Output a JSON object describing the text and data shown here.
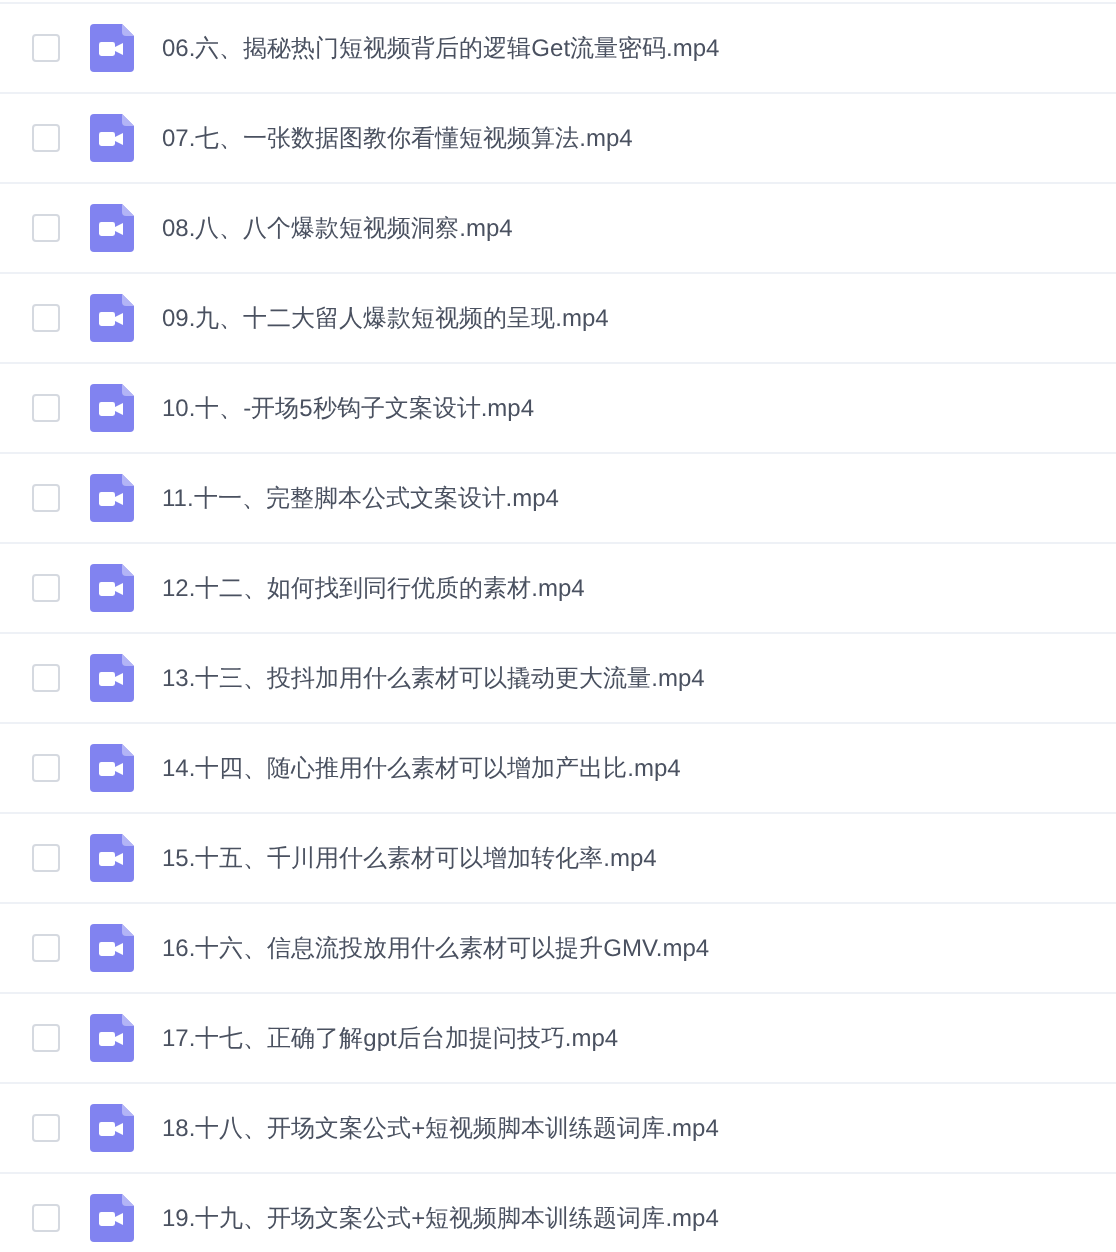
{
  "files": [
    {
      "name": "06.六、揭秘热门短视频背后的逻辑Get流量密码.mp4",
      "checked": false
    },
    {
      "name": "07.七、一张数据图教你看懂短视频算法.mp4",
      "checked": false
    },
    {
      "name": "08.八、八个爆款短视频洞察.mp4",
      "checked": false
    },
    {
      "name": "09.九、十二大留人爆款短视频的呈现.mp4",
      "checked": false
    },
    {
      "name": "10.十、-开场5秒钩子文案设计.mp4",
      "checked": false
    },
    {
      "name": "11.十一、完整脚本公式文案设计.mp4",
      "checked": false
    },
    {
      "name": "12.十二、如何找到同行优质的素材.mp4",
      "checked": false
    },
    {
      "name": "13.十三、投抖加用什么素材可以撬动更大流量.mp4",
      "checked": false
    },
    {
      "name": "14.十四、随心推用什么素材可以增加产出比.mp4",
      "checked": false
    },
    {
      "name": "15.十五、千川用什么素材可以增加转化率.mp4",
      "checked": false
    },
    {
      "name": "16.十六、信息流投放用什么素材可以提升GMV.mp4",
      "checked": false
    },
    {
      "name": "17.十七、正确了解gpt后台加提问技巧.mp4",
      "checked": false
    },
    {
      "name": "18.十八、开场文案公式+短视频脚本训练题词库.mp4",
      "checked": false
    },
    {
      "name": "19.十九、开场文案公式+短视频脚本训练题词库.mp4",
      "checked": false
    }
  ]
}
